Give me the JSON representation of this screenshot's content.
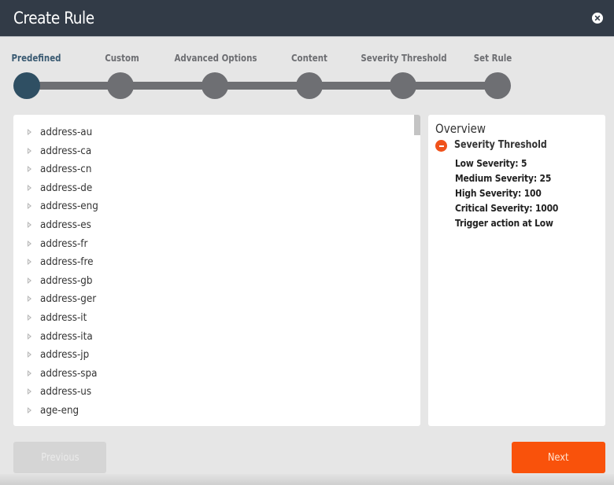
{
  "dialog": {
    "title": "Create Rule",
    "close_icon": "close-circle-icon"
  },
  "stepper": {
    "steps": [
      {
        "label": "Predefined",
        "active": true
      },
      {
        "label": "Custom",
        "active": false
      },
      {
        "label": "Advanced Options",
        "active": false
      },
      {
        "label": "Content",
        "active": false
      },
      {
        "label": "Severity Threshold",
        "active": false
      },
      {
        "label": "Set Rule",
        "active": false
      }
    ],
    "active_color": "#2f4f63",
    "inactive_color": "#6e6f73"
  },
  "rule_list": {
    "expand_icon": "triangle-right-icon",
    "items": [
      "address-au",
      "address-ca",
      "address-cn",
      "address-de",
      "address-eng",
      "address-es",
      "address-fr",
      "address-fre",
      "address-gb",
      "address-ger",
      "address-it",
      "address-ita",
      "address-jp",
      "address-spa",
      "address-us",
      "age-eng"
    ]
  },
  "overview": {
    "title": "Overview",
    "section": {
      "toggle_icon": "minus-circle-icon",
      "title": "Severity Threshold",
      "details": [
        "Low Severity: 5",
        "Medium Severity: 25",
        "High Severity: 100",
        "Critical Severity: 1000",
        "Trigger action at Low"
      ]
    }
  },
  "footer": {
    "previous_label": "Previous",
    "next_label": "Next",
    "accent_color": "#f9520b"
  }
}
